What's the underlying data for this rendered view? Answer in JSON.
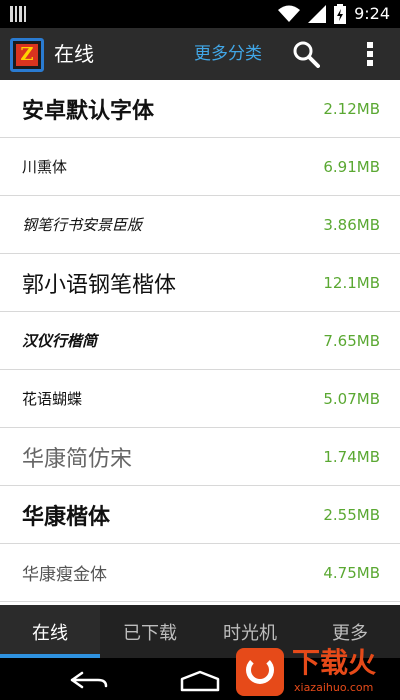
{
  "status_bar": {
    "time": "9:24"
  },
  "action_bar": {
    "title": "在线",
    "more_categories": "更多分类",
    "search_icon": "search-icon",
    "overflow_icon": "overflow-menu-icon"
  },
  "fonts": [
    {
      "name": "安卓默认字体",
      "size": "2.12MB"
    },
    {
      "name": "川熏体",
      "size": "6.91MB"
    },
    {
      "name": "钢笔行书安景臣版",
      "size": "3.86MB"
    },
    {
      "name": "郭小语钢笔楷体",
      "size": "12.1MB"
    },
    {
      "name": "汉仪行楷简",
      "size": "7.65MB"
    },
    {
      "name": "花语蝴蝶",
      "size": "5.07MB"
    },
    {
      "name": "华康简仿宋",
      "size": "1.74MB"
    },
    {
      "name": "华康楷体",
      "size": "2.55MB"
    },
    {
      "name": "华康瘦金体",
      "size": "4.75MB"
    }
  ],
  "tabs": [
    {
      "label": "在线",
      "active": true
    },
    {
      "label": "已下载",
      "active": false
    },
    {
      "label": "时光机",
      "active": false
    },
    {
      "label": "更多",
      "active": false
    }
  ],
  "watermark": {
    "title": "下载火",
    "subtitle": "xiazaihuo.com"
  },
  "colors": {
    "accent": "#2f92e0",
    "size_text": "#5aa832",
    "link": "#41a6e6",
    "brand": "#e64a19"
  }
}
